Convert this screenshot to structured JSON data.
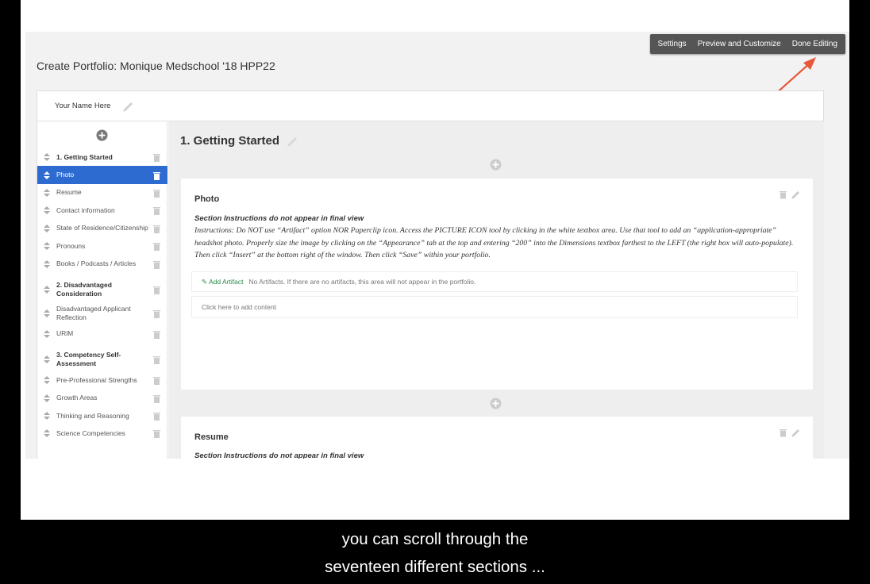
{
  "topbar": {
    "settings": "Settings",
    "preview": "Preview and Customize",
    "done": "Done Editing"
  },
  "page": {
    "title": "Create Portfolio: Monique Medschool '18 HPP22"
  },
  "portfolio": {
    "name_placeholder": "Your Name Here"
  },
  "sidebar": {
    "items": [
      {
        "label": "1. Getting Started"
      },
      {
        "label": "Photo"
      },
      {
        "label": "Resume"
      },
      {
        "label": "Contact information"
      },
      {
        "label": "State of Residence/Citizenship"
      },
      {
        "label": "Pronouns"
      },
      {
        "label": "Books / Podcasts / Articles"
      },
      {
        "label": "2. Disadvantaged Consideration"
      },
      {
        "label": "Disadvantaged Applicant Reflection"
      },
      {
        "label": "URiM"
      },
      {
        "label": "3. Competency Self-Assessment"
      },
      {
        "label": "Pre-Professional Strengths"
      },
      {
        "label": "Growth Areas"
      },
      {
        "label": "Thinking and Reasoning"
      },
      {
        "label": "Science Competencies"
      }
    ]
  },
  "main": {
    "section_title": "1. Getting Started",
    "cards": [
      {
        "title": "Photo",
        "instructions_heading": "Section Instructions do not appear in final view",
        "instructions": "Instructions: Do NOT use “Artifact” option NOR Paperclip icon. Access the PICTURE ICON tool by clicking in the white textbox area. Use that tool to  add an “application-appropriate” headshot photo. Properly size the image by clicking on the “Appearance” tab at the top and entering “200” into the Dimensions textbox farthest to the LEFT (the right box will auto-populate). Then click “Insert” at the bottom right of the window. Then click “Save” within your portfolio.",
        "add_artifact": "Add Artifact",
        "no_artifacts": "No Artifacts. If there are no artifacts, this area will not appear in the portfolio.",
        "add_content": "Click here to add content"
      },
      {
        "title": "Resume",
        "instructions_heading": "Section Instructions do not appear in final view"
      }
    ]
  },
  "caption": {
    "line1": "you can scroll through the",
    "line2": "seventeen different sections ..."
  },
  "colors": {
    "accent": "#2e6bd1",
    "topbar": "#555555",
    "arrow": "#e8583a",
    "artifact_link": "#2a8a4a"
  }
}
